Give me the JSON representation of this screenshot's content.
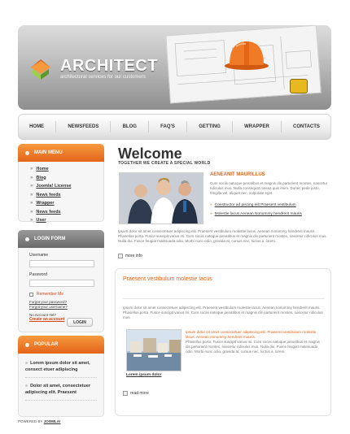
{
  "header": {
    "logo_title": "ARCHITECT",
    "logo_subtitle": "architectural services for our customers"
  },
  "nav": {
    "items": [
      "HOME",
      "NEWSFEEDS",
      "BLOG",
      "FAQ'S",
      "GETTING",
      "WRAPPER",
      "CONTACTS"
    ]
  },
  "main_menu": {
    "title": "MAIN MENU",
    "items": [
      "Home",
      "Blog",
      "Joomla! License",
      "News feeds",
      "Wrapper",
      "News feeds",
      "User"
    ]
  },
  "login_form": {
    "title": "LOGIN FORM",
    "username_label": "Username",
    "password_label": "Password",
    "remember_label": "Remember Me",
    "forgot_password": "Forgot your password?",
    "forgot_username": "Forgot your username?",
    "no_account": "No Account Yet?",
    "create_account": "Create an account",
    "login_button": "LOGIN"
  },
  "popular": {
    "title": "POPULAR",
    "items": [
      "Lorem ipsum dolor sit amet, consect etuer adipiscing",
      "Dolor sit amet, consectetuer adipiscing elit. Praesent"
    ]
  },
  "welcome": {
    "heading": "Welcome",
    "tagline": "TOGETHER WE CREATE A SPECIAL WORLD",
    "intro_title": "AENEANIT MAURILLUS",
    "intro_text": "Cum sociis natoque penatibus et magnis dis parturient montes, nascetur ridiculus mus. Nulla consequat massa quis enim. Donec pede justo, fringilla vel, aliquet nec, vulputate eget.",
    "bullets": [
      "Constructor ad piscing elit Praesent vestibulum",
      "Molestie lacus Aenean Nonummy hendrerit mauris"
    ],
    "paragraph": "Ipsum dolor sit amet consectetuer adipiscing elit. Praesent vestibulum molestie lacus. Aenean nonummy hendrerit mauris. Phasellus porta. Fusce suscipit varius mi. Cum sociis natoque penatibus et magnis dis parturient montes, nascetur ridiculus mus. Nulla dui. Fusce feugiat malesuada odio. Morbi nunc odio, gravida at, cursus nec, luctus a, lorem.",
    "more_info": "more info"
  },
  "article": {
    "title": "Praesent vestibulum molestie lacus",
    "paragraph": "Ipsum dolor sit amet consectetuer adipiscing elit. Praesent vestibulum molestie lacus. Aenean nonummy hendrerit mauris. Phasellus porta. Fusce suscipit varius mi. Cum sociis natoque penatibus et magnis dis parturient montes, nascetur ridiculus mus.",
    "orange_text": "Ipsum dolor sit amet consectetuer adipiscing elit. Praesent vestibulum molestie lacus. Aenean nonummy hendrerit mauris.",
    "gray_text": "Phasellus porta. Fusce suscipit varius mi. Cum sociis natoque penatibus et magnis dis parturient montes, nascetur ridiculus mus. Nulla dui. Fusce feugiat malesuada odio. Morbi nunc odio, gravida at, cursus nec, luctus a, lorem.",
    "image_caption": "Lorem ipsum dolor",
    "read_more": "read more"
  },
  "footer": {
    "powered_by": "POWERED BY",
    "brand": "JOOMLA!"
  }
}
